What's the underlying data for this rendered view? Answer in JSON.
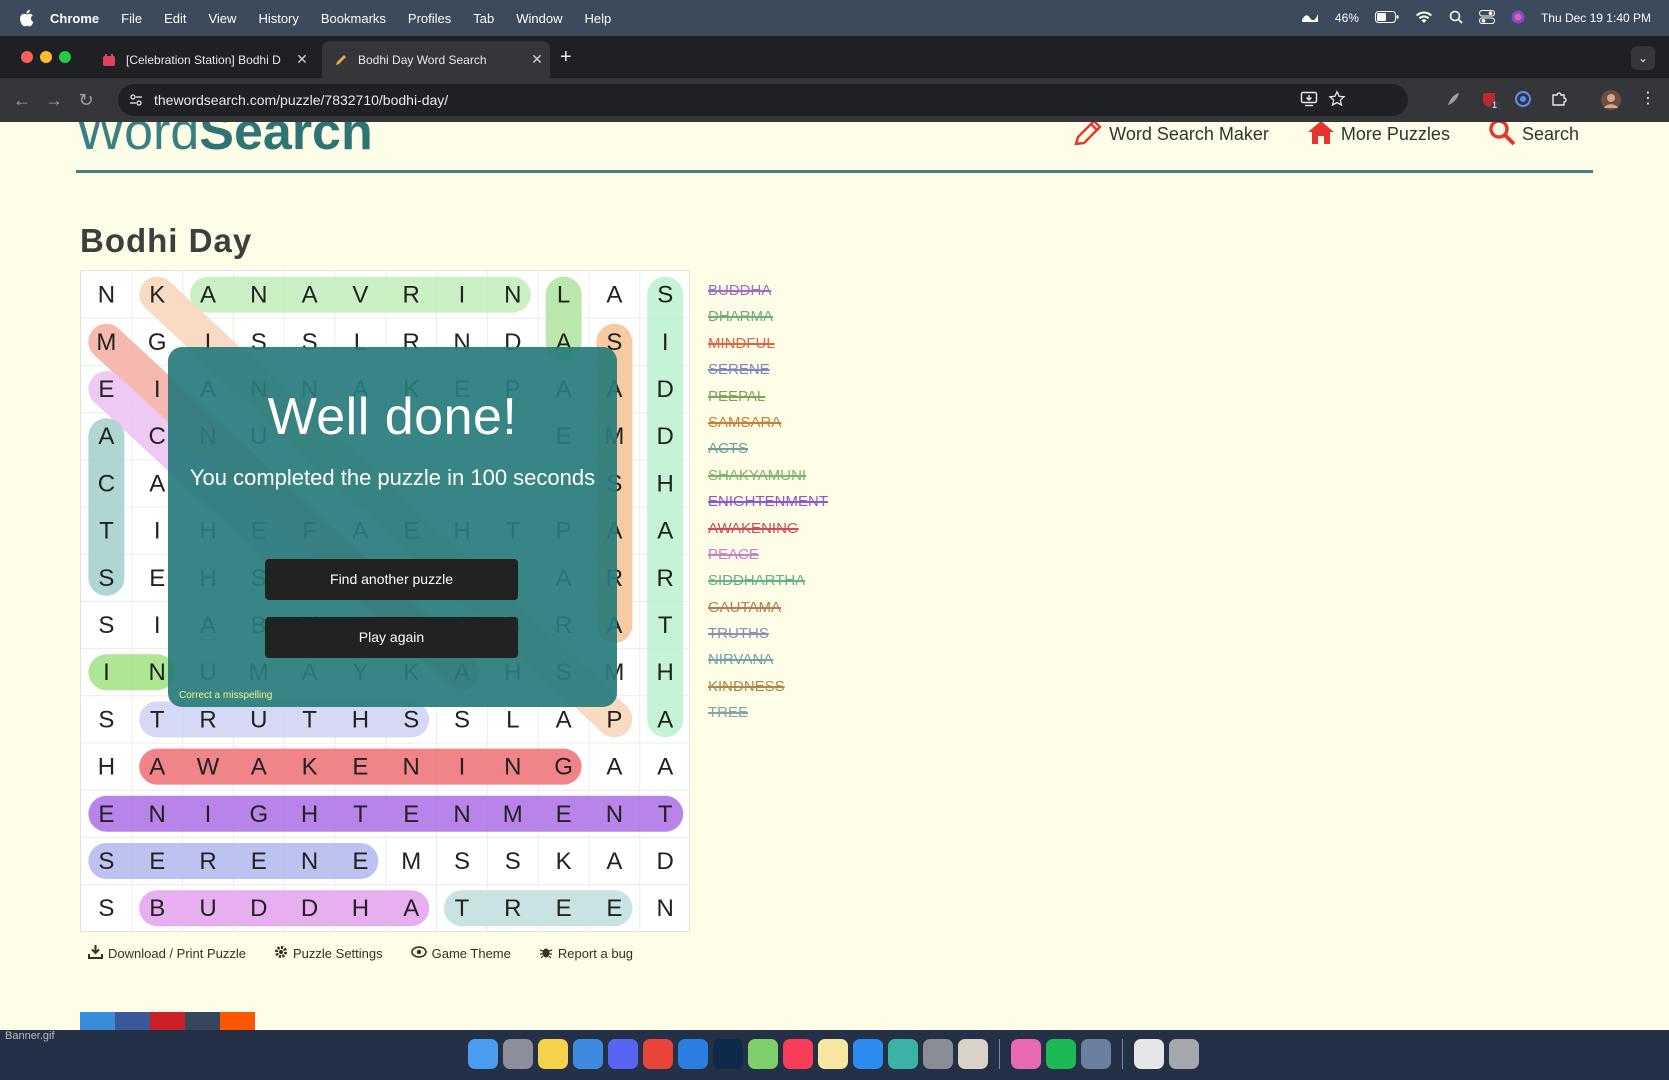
{
  "menubar": {
    "app": "Chrome",
    "items": [
      "File",
      "Edit",
      "View",
      "History",
      "Bookmarks",
      "Profiles",
      "Tab",
      "Window",
      "Help"
    ],
    "battery": "46%",
    "clock": "Thu Dec 19  1:40 PM"
  },
  "tabs": [
    {
      "title": "[Celebration Station] Bodhi D"
    },
    {
      "title": "Bodhi Day Word Search"
    }
  ],
  "omnibox": {
    "url": "thewordsearch.com/puzzle/7832710/bodhi-day/"
  },
  "extension_badge": "1",
  "site": {
    "logo_part1": "Word",
    "logo_part2": "Search",
    "nav": [
      "Word Search Maker",
      "More Puzzles",
      "Search"
    ]
  },
  "puzzle": {
    "title": "Bodhi Day",
    "grid": [
      [
        "N",
        "K",
        "A",
        "N",
        "A",
        "V",
        "R",
        "I",
        "N",
        "L",
        "A",
        "S"
      ],
      [
        "M",
        "G",
        "I",
        "S",
        "S",
        "L",
        "R",
        "N",
        "D",
        "A",
        "S",
        "I"
      ],
      [
        "E",
        "I",
        "A",
        "N",
        "N",
        "A",
        "K",
        "E",
        "P",
        "A",
        "A",
        "D"
      ],
      [
        "A",
        "C",
        "N",
        "U",
        "",
        "",
        "",
        "",
        "",
        "E",
        "M",
        "D"
      ],
      [
        "C",
        "A",
        "",
        "",
        "",
        "",
        "",
        "",
        "",
        "",
        "S",
        "H"
      ],
      [
        "T",
        "I",
        "H",
        "E",
        "F",
        "A",
        "E",
        "H",
        "T",
        "P",
        "A",
        "A"
      ],
      [
        "S",
        "E",
        "H",
        "S",
        "",
        "",
        "",
        "",
        "",
        "A",
        "R",
        "R"
      ],
      [
        "S",
        "I",
        "A",
        "B",
        "M",
        "L",
        "I",
        "A",
        "S",
        "R",
        "A",
        "T"
      ],
      [
        "I",
        "N",
        "U",
        "M",
        "A",
        "Y",
        "K",
        "A",
        "H",
        "S",
        "M",
        "H"
      ],
      [
        "S",
        "T",
        "R",
        "U",
        "T",
        "H",
        "S",
        "S",
        "L",
        "A",
        "P",
        "A"
      ],
      [
        "H",
        "A",
        "W",
        "A",
        "K",
        "E",
        "N",
        "I",
        "N",
        "G",
        "A",
        "A"
      ],
      [
        "E",
        "N",
        "I",
        "G",
        "H",
        "T",
        "E",
        "N",
        "M",
        "E",
        "N",
        "T"
      ],
      [
        "S",
        "E",
        "R",
        "E",
        "N",
        "E",
        "M",
        "S",
        "S",
        "K",
        "A",
        "D"
      ],
      [
        "S",
        "B",
        "U",
        "D",
        "D",
        "H",
        "A",
        "T",
        "R",
        "E",
        "E",
        "N"
      ]
    ],
    "highlights": [
      {
        "r1": 0,
        "c1": 2,
        "r2": 0,
        "c2": 8,
        "color": "#c6efbf"
      },
      {
        "r1": 0,
        "c1": 9,
        "r2": 1,
        "c2": 9,
        "color": "#b5e7a6"
      },
      {
        "r1": 0,
        "c1": 11,
        "r2": 9,
        "c2": 11,
        "color": "#bff2d2"
      },
      {
        "r1": 1,
        "c1": 10,
        "r2": 7,
        "c2": 10,
        "color": "#f7c79b"
      },
      {
        "r1": 0,
        "c1": 1,
        "r2": 9,
        "c2": 10,
        "color": "#f9d8bf"
      },
      {
        "r1": 1,
        "c1": 0,
        "r2": 8,
        "c2": 7,
        "color": "#f6b4a9"
      },
      {
        "r1": 2,
        "c1": 0,
        "r2": 6,
        "c2": 4,
        "color": "#ecc5f3"
      },
      {
        "r1": 3,
        "c1": 0,
        "r2": 6,
        "c2": 0,
        "color": "#a9d3cf"
      },
      {
        "r1": 8,
        "c1": 0,
        "r2": 8,
        "c2": 1,
        "color": "#a7e58a"
      },
      {
        "r1": 9,
        "c1": 1,
        "r2": 9,
        "c2": 6,
        "color": "#d2d6f5"
      },
      {
        "r1": 10,
        "c1": 1,
        "r2": 10,
        "c2": 9,
        "color": "#f07a80"
      },
      {
        "r1": 11,
        "c1": 0,
        "r2": 11,
        "c2": 11,
        "color": "#b27ae8"
      },
      {
        "r1": 12,
        "c1": 0,
        "r2": 12,
        "c2": 5,
        "color": "#b9bdf0"
      },
      {
        "r1": 13,
        "c1": 1,
        "r2": 13,
        "c2": 6,
        "color": "#e6a8ef"
      },
      {
        "r1": 13,
        "c1": 7,
        "r2": 13,
        "c2": 10,
        "color": "#c4e1e0"
      }
    ],
    "words": [
      {
        "text": "BUDDHA",
        "color": "#a06bc0"
      },
      {
        "text": "DHARMA",
        "color": "#6fae7a"
      },
      {
        "text": "MINDFUL",
        "color": "#d66a48"
      },
      {
        "text": "SERENE",
        "color": "#7f86b8"
      },
      {
        "text": "PEEPAL",
        "color": "#7fa35a"
      },
      {
        "text": "SAMSARA",
        "color": "#c77f3a"
      },
      {
        "text": "ACTS",
        "color": "#6e9e99"
      },
      {
        "text": "SHAKYAMUNI",
        "color": "#7fb36c"
      },
      {
        "text": "ENIGHTENMENT",
        "color": "#8d58c9"
      },
      {
        "text": "AWAKENING",
        "color": "#cc4e56"
      },
      {
        "text": "PEACE",
        "color": "#c483c8"
      },
      {
        "text": "SIDDHARTHA",
        "color": "#67b08b"
      },
      {
        "text": "GAUTAMA",
        "color": "#b47c52"
      },
      {
        "text": "TRUTHS",
        "color": "#8b8fb1"
      },
      {
        "text": "NIRVANA",
        "color": "#74a2a6"
      },
      {
        "text": "KINDNESS",
        "color": "#b2864e"
      },
      {
        "text": "TREE",
        "color": "#86a5a3"
      }
    ]
  },
  "modal": {
    "heading": "Well done!",
    "subtext": "You completed the puzzle in 100 seconds",
    "btn_another": "Find another puzzle",
    "btn_again": "Play again",
    "correct_link": "Correct a misspelling"
  },
  "tools": {
    "download": "Download / Print Puzzle",
    "settings": "Puzzle Settings",
    "theme": "Game Theme",
    "bug": "Report a bug"
  },
  "status_label": "Banner.gif",
  "colors": {
    "brand": "#3a8080",
    "accent_red": "#e8342c",
    "page_bg": "#fefde8"
  }
}
